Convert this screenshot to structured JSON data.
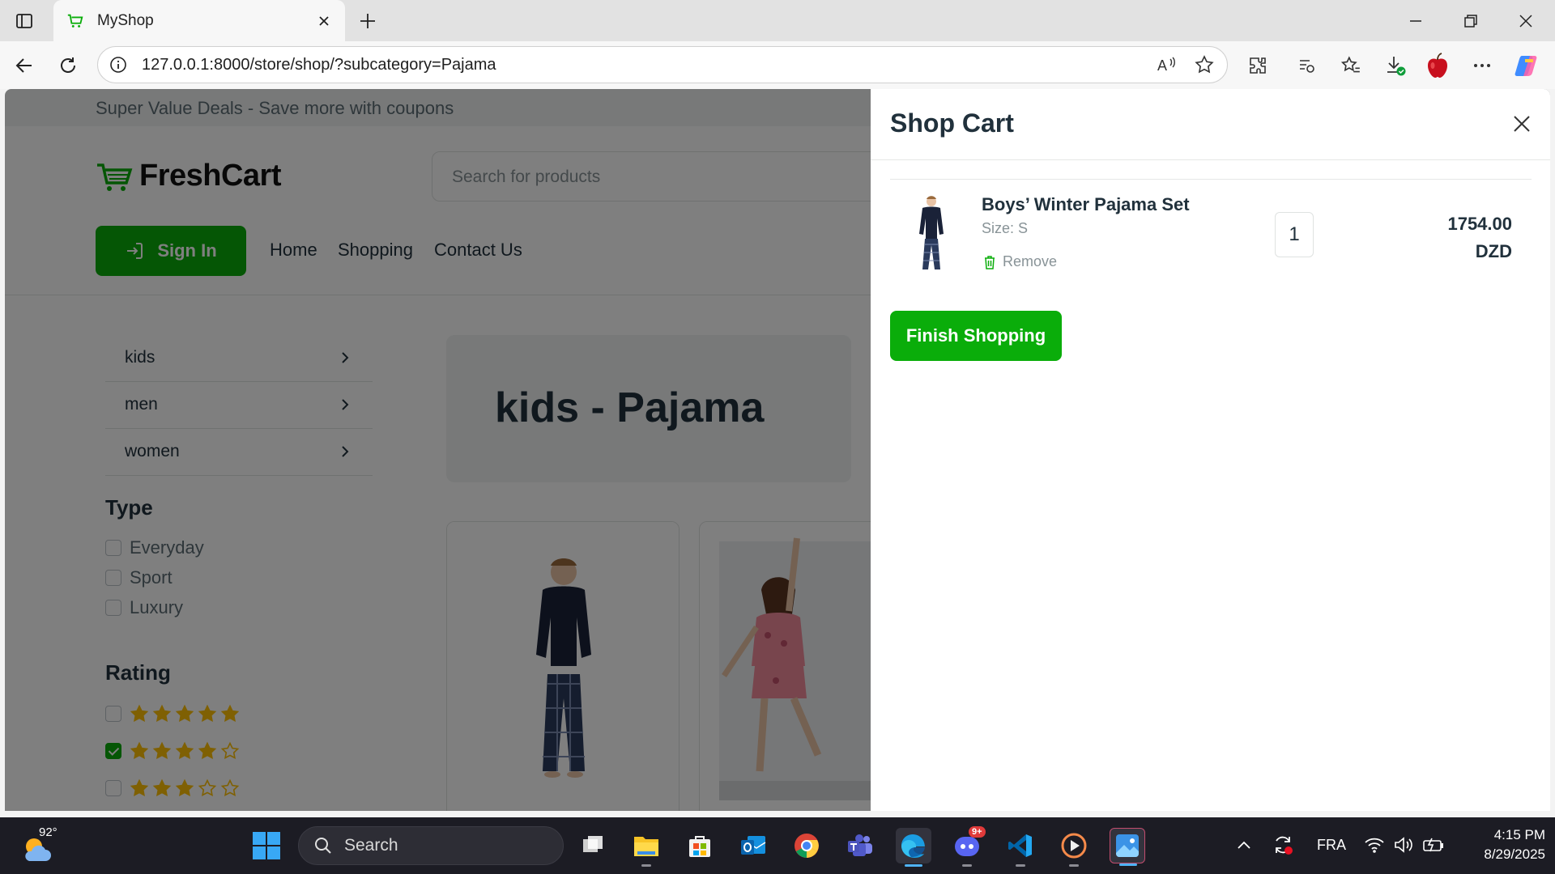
{
  "browser": {
    "tab_title": "MyShop",
    "url": "127.0.0.1:8000/store/shop/?subcategory=Pajama"
  },
  "site": {
    "promo_text": "Super Value Deals - Save more with coupons",
    "logo_text": "FreshCart",
    "search_placeholder": "Search for products",
    "sign_in_label": "Sign In",
    "nav": [
      "Home",
      "Shopping",
      "Contact Us"
    ],
    "categories": [
      "kids",
      "men",
      "women"
    ],
    "type_heading": "Type",
    "types": [
      {
        "label": "Everyday",
        "checked": false
      },
      {
        "label": "Sport",
        "checked": false
      },
      {
        "label": "Luxury",
        "checked": false
      }
    ],
    "rating_heading": "Rating",
    "ratings": [
      {
        "stars": 5,
        "checked": false
      },
      {
        "stars": 4,
        "checked": true
      },
      {
        "stars": 3,
        "checked": false
      }
    ],
    "page_heading": "kids - Pajama"
  },
  "cart": {
    "title": "Shop Cart",
    "items": [
      {
        "name": "Boys’ Winter Pajama Set",
        "size": "Size: S",
        "remove_label": "Remove",
        "quantity": "1",
        "price": "1754.00",
        "currency": "DZD"
      }
    ],
    "finish_label": "Finish Shopping"
  },
  "taskbar": {
    "weather_temp": "92°",
    "search_label": "Search",
    "discord_badge": "9+",
    "language": "FRA",
    "time": "4:15 PM",
    "date": "8/29/2025"
  },
  "colors": {
    "brand_green": "#0aad0a",
    "overlay": "rgba(0,0,0,0.5)",
    "star": "#ffc107"
  }
}
